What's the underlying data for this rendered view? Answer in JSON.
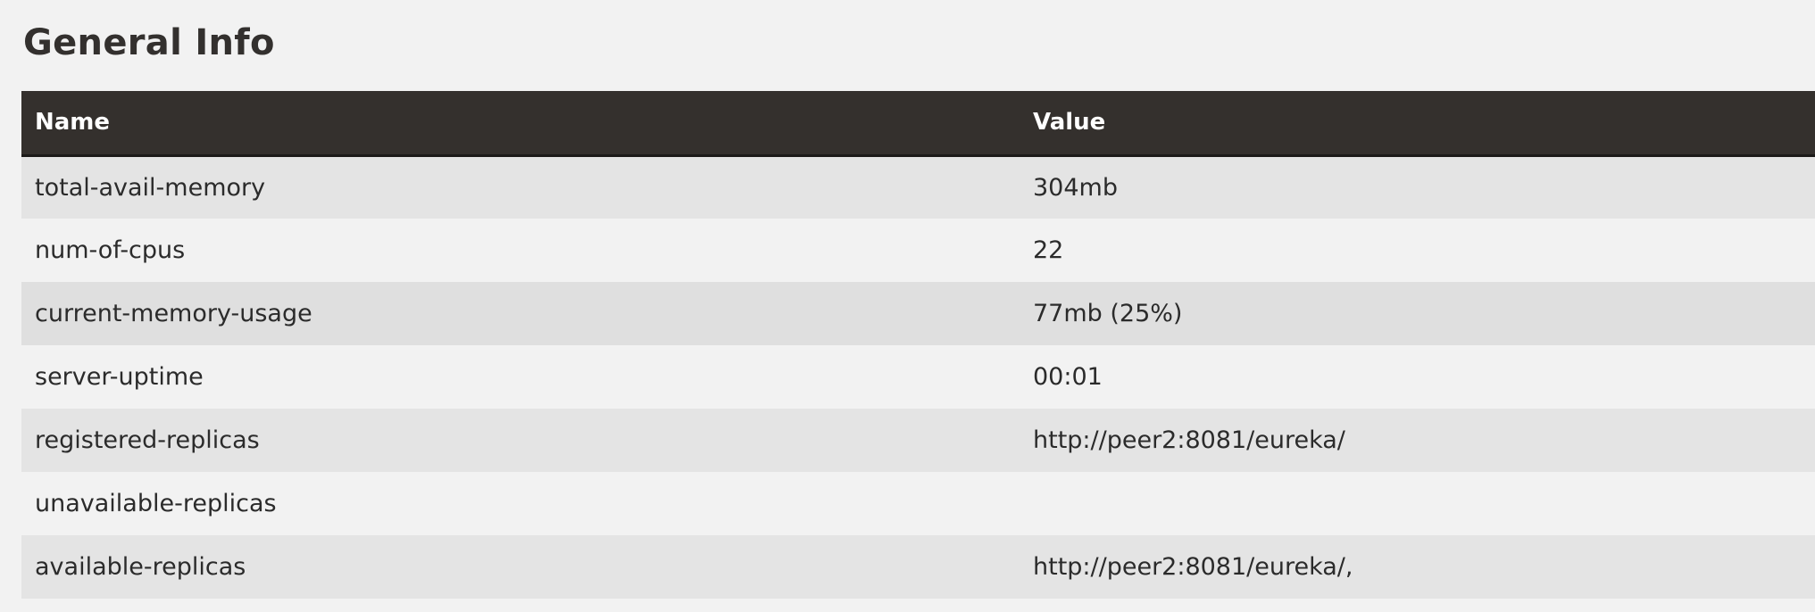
{
  "section": {
    "title": "General Info"
  },
  "table": {
    "headers": {
      "name": "Name",
      "value": "Value"
    },
    "rows": [
      {
        "name": "total-avail-memory",
        "value": "304mb"
      },
      {
        "name": "num-of-cpus",
        "value": "22"
      },
      {
        "name": "current-memory-usage",
        "value": "77mb (25%)"
      },
      {
        "name": "server-uptime",
        "value": "00:01"
      },
      {
        "name": "registered-replicas",
        "value": "http://peer2:8081/eureka/"
      },
      {
        "name": "unavailable-replicas",
        "value": ""
      },
      {
        "name": "available-replicas",
        "value": "http://peer2:8081/eureka/,"
      }
    ]
  },
  "colors": {
    "header_bg": "#34302d",
    "row_alt_bg": "#e4e4e4",
    "page_bg": "#f2f2f2"
  }
}
